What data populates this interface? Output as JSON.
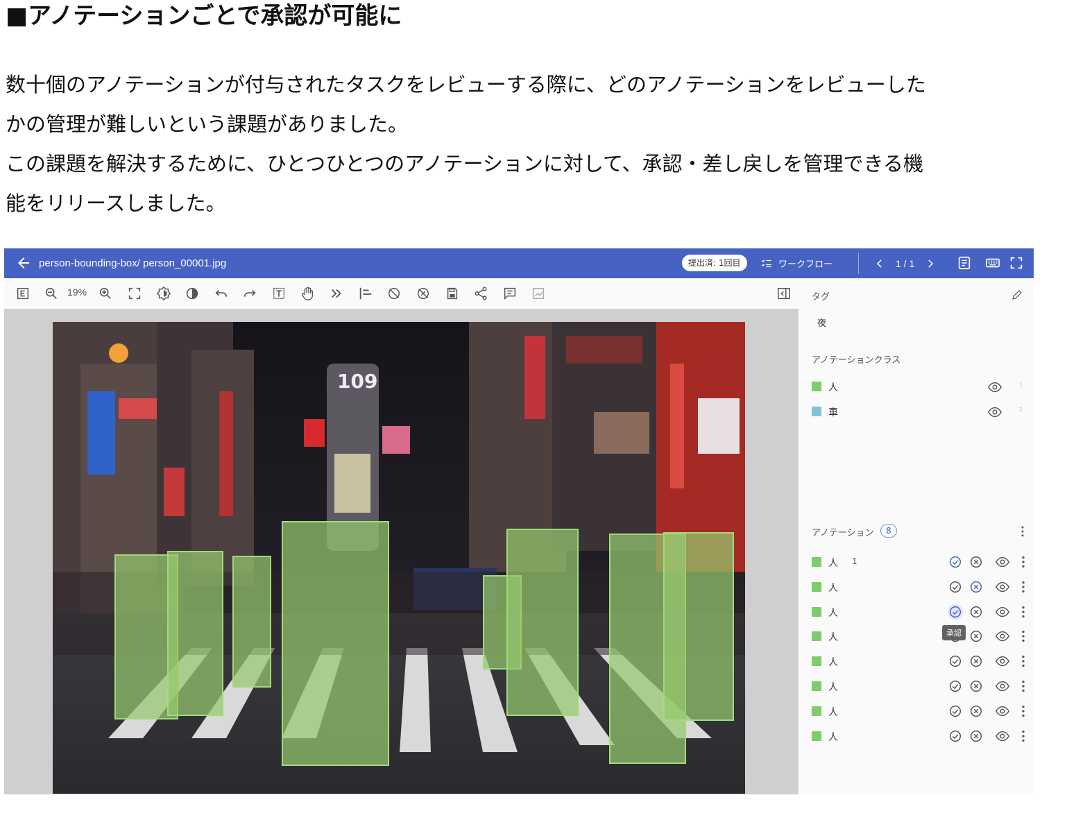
{
  "article": {
    "heading": "■アノテーションごとで承認が可能に",
    "lines": [
      "数十個のアノテーションが付与されたタスクをレビューする際に、どのアノテーションをレビューした",
      "かの管理が難しいという課題がありました。",
      "この課題を解決するために、ひとつひとつのアノテーションに対して、承認・差し戻しを管理できる機",
      "能をリリースしました。"
    ]
  },
  "header": {
    "path": "person-bounding-box/ person_00001.jpg",
    "status_badge": "提出済: 1回目",
    "workflow_label": "ワークフロー",
    "pagination": "1 / 1"
  },
  "toolbar": {
    "zoom_value": "19%"
  },
  "sidebar": {
    "tags_title": "タグ",
    "tag_value": "夜",
    "classes_title": "アノテーションクラス",
    "classes": [
      {
        "name": "人",
        "color": "#7dce6a",
        "count": "1"
      },
      {
        "name": "車",
        "color": "#7ec4d6",
        "count": "2"
      }
    ],
    "annotations_title": "アノテーション",
    "annotations_count": "8",
    "annotations": [
      {
        "name": "人",
        "number": "1",
        "state": "approved"
      },
      {
        "name": "人",
        "number": "",
        "state": "rejected"
      },
      {
        "name": "人",
        "number": "",
        "state": "hover-approve"
      },
      {
        "name": "人",
        "number": "",
        "state": "none"
      },
      {
        "name": "人",
        "number": "",
        "state": "none"
      },
      {
        "name": "人",
        "number": "",
        "state": "none"
      },
      {
        "name": "人",
        "number": "",
        "state": "none"
      },
      {
        "name": "人",
        "number": "",
        "state": "none"
      }
    ],
    "tooltip": "承認"
  },
  "colors": {
    "header_bg": "#4662c2",
    "person_class": "#7dce6a",
    "car_class": "#7ec4d6",
    "accent": "#4662c2"
  }
}
